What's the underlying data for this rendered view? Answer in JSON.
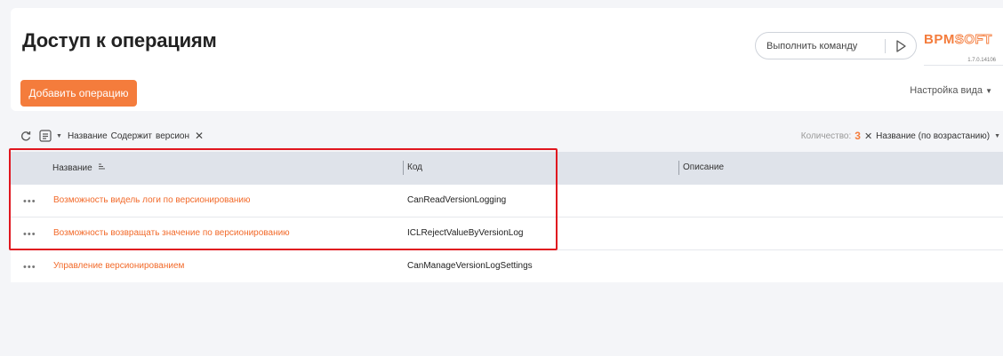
{
  "header": {
    "title": "Доступ к операциям",
    "command_placeholder": "Выполнить команду",
    "logo_text": "BPMSOFT",
    "version": "1.7.0.14106",
    "add_button": "Добавить операцию",
    "view_settings": "Настройка вида"
  },
  "filter": {
    "field": "Название",
    "operator": "Содержит",
    "value": "версион"
  },
  "summary": {
    "count_label": "Количество:",
    "count": "3",
    "sort": "Название (по возрастанию)"
  },
  "grid": {
    "columns": [
      "Название",
      "Код",
      "Описание"
    ],
    "rows": [
      {
        "name": "Возможность видель логи по версионированию",
        "code": "CanReadVersionLogging"
      },
      {
        "name": "Возможность возвращать значение по версионированию",
        "code": "ICLRejectValueByVersionLog"
      },
      {
        "name": "Управление версионированием",
        "code": "CanManageVersionLogSettings"
      }
    ]
  },
  "colors": {
    "accent": "#f47c3c",
    "highlight": "#e0161f",
    "header_bg": "#dfe3ea"
  },
  "icons": [
    "refresh-icon",
    "filter-list-icon",
    "caret-down-icon",
    "close-icon",
    "run-icon",
    "sort-icon",
    "more-icon"
  ]
}
